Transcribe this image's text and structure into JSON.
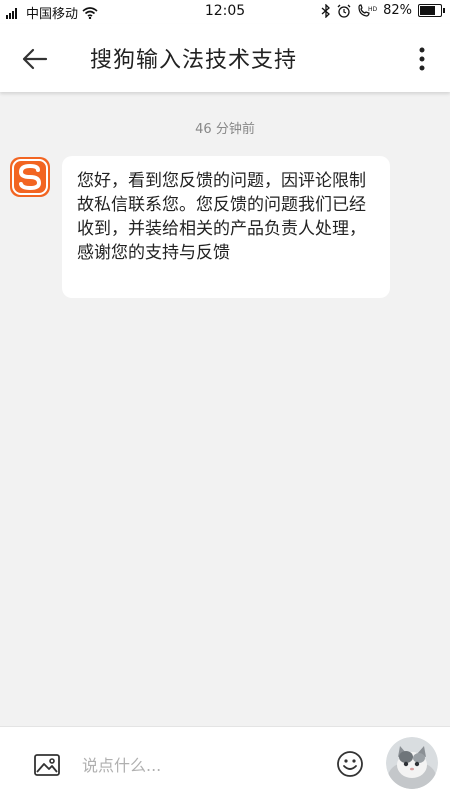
{
  "status_bar": {
    "carrier": "中国移动",
    "time": "12:05",
    "battery": "82%",
    "battery_level": 0.82
  },
  "header": {
    "title": "搜狗输入法技术支持"
  },
  "chat": {
    "timestamp": "46 分钟前",
    "messages": [
      {
        "sender": "sogou",
        "text": "您好，看到您反馈的问题，因评论限制故私信联系您。您反馈的问题我们已经收到，并装给相关的产品负责人处理，感谢您的支持与反馈"
      }
    ]
  },
  "input_bar": {
    "placeholder": "说点什么..."
  },
  "colors": {
    "brand": "#f26522",
    "background": "#f2f2f2"
  },
  "icons": [
    "signal-icon",
    "wifi-icon",
    "bluetooth-icon",
    "alarm-icon",
    "hd-call-icon",
    "battery-icon",
    "back-arrow-icon",
    "more-vertical-icon",
    "sogou-logo-icon",
    "image-icon",
    "emoji-icon",
    "user-avatar"
  ]
}
